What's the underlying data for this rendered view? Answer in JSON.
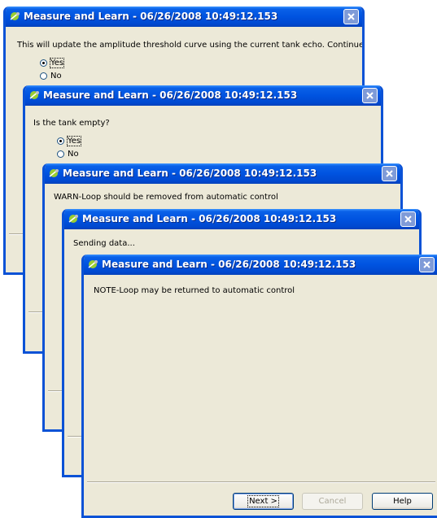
{
  "windows": [
    {
      "title": "Measure and Learn - 06/26/2008 10:49:12.153",
      "message": "This will update the amplitude threshold curve using the current tank echo. Continue?",
      "options": [
        {
          "label": "Yes",
          "checked": true
        },
        {
          "label": "No",
          "checked": false
        }
      ]
    },
    {
      "title": "Measure and Learn - 06/26/2008 10:49:12.153",
      "message": "Is the tank empty?",
      "options": [
        {
          "label": "Yes",
          "checked": true
        },
        {
          "label": "No",
          "checked": false
        }
      ]
    },
    {
      "title": "Measure and Learn - 06/26/2008 10:49:12.153",
      "message": "WARN-Loop should be removed from automatic control"
    },
    {
      "title": "Measure and Learn - 06/26/2008 10:49:12.153",
      "message": "Sending data..."
    },
    {
      "title": "Measure and Learn - 06/26/2008 10:49:12.153",
      "message": "NOTE-Loop may be returned to automatic control",
      "buttons": {
        "next": "Next >",
        "cancel": "Cancel",
        "help": "Help"
      }
    }
  ],
  "icons": {
    "app": "satellite-dish-icon",
    "close": "close-icon"
  },
  "colors": {
    "titlebar": "#0053e0",
    "window_border": "#0a52d6",
    "face": "#ece9d8"
  }
}
